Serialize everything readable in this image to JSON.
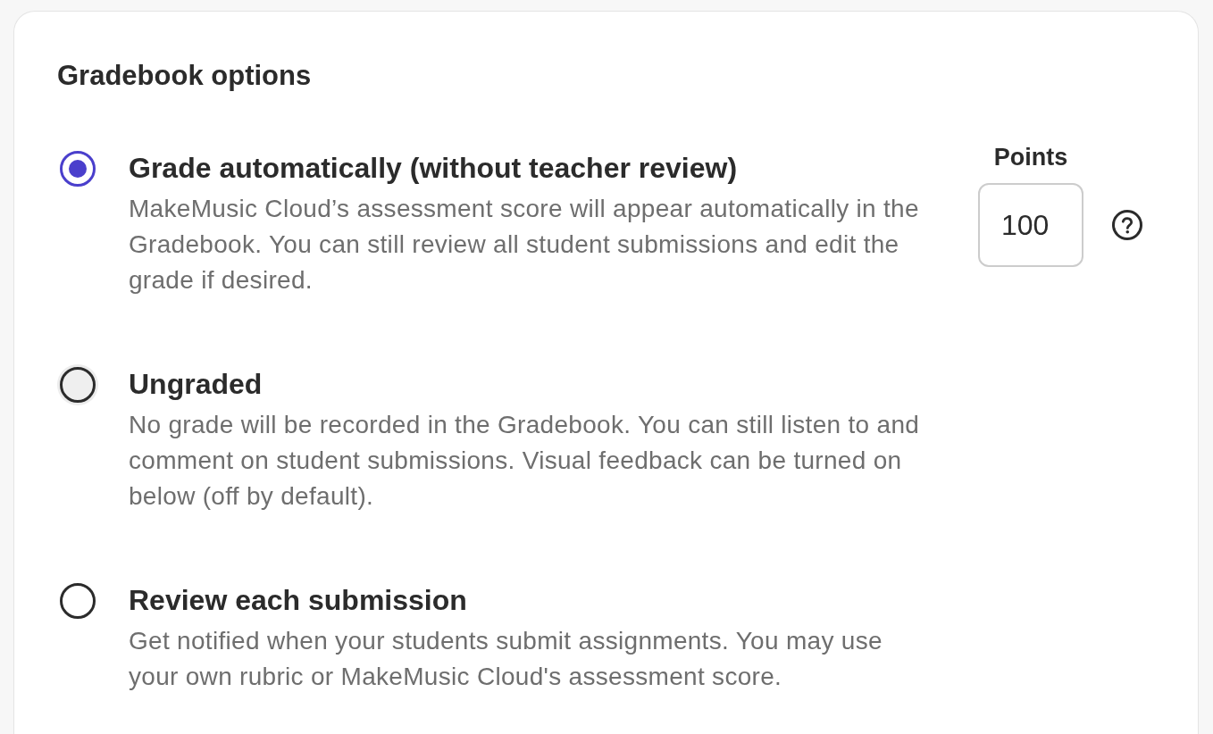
{
  "section": {
    "title": "Gradebook options"
  },
  "grading_options": [
    {
      "title": "Grade automatically (without teacher review)",
      "description": "MakeMusic Cloud’s assessment score will appear automatically in the Gradebook. You can still review all student submissions and edit the grade if desired.",
      "selected": true,
      "hovered": false
    },
    {
      "title": "Ungraded",
      "description": "No grade will be recorded in the Gradebook. You can still listen to and comment on student submissions. Visual feedback can be turned on below (off by default).",
      "selected": false,
      "hovered": true
    },
    {
      "title": "Review each submission",
      "description": "Get notified when your students submit assignments. You may use your own rubric or MakeMusic Cloud's assessment score.",
      "selected": false,
      "hovered": false
    }
  ],
  "points": {
    "label": "Points",
    "value": "100"
  }
}
